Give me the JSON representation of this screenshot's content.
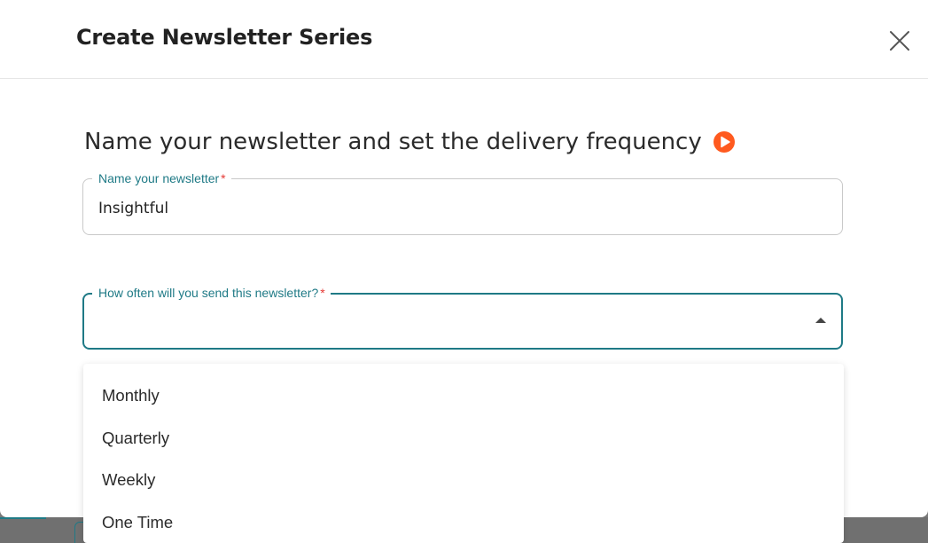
{
  "modal": {
    "title": "Create Newsletter Series",
    "close_icon": "close-icon"
  },
  "step": {
    "heading": "Name your newsletter and set the delivery frequency",
    "video_icon": "play-icon",
    "accent_color": "#ff5a1f"
  },
  "name_field": {
    "label": "Name your newsletter",
    "required_marker": "*",
    "value": "Insightful"
  },
  "frequency_field": {
    "label": "How often will you send this newsletter?",
    "required_marker": "*",
    "value": "",
    "expanded": true,
    "options": [
      "Monthly",
      "Quarterly",
      "Weekly",
      "One Time"
    ]
  },
  "theme": {
    "primary": "#1f7a86",
    "required": "#e53935"
  }
}
